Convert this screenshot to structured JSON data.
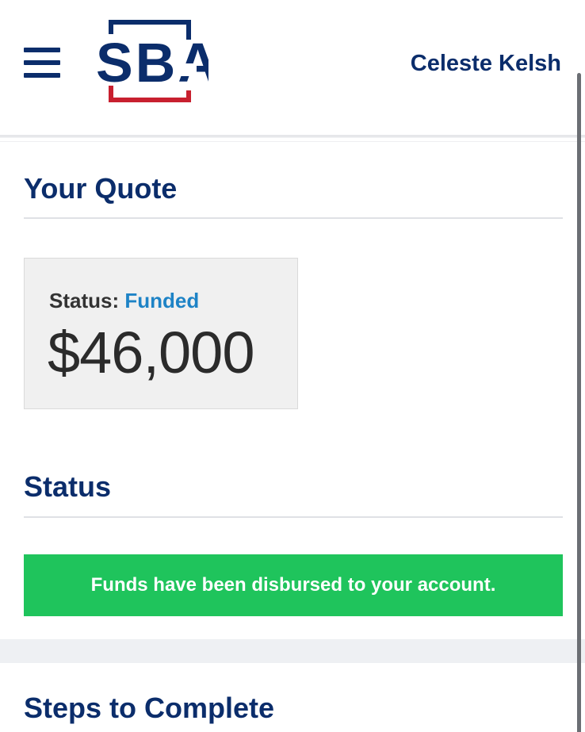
{
  "header": {
    "logo_text": "SBA",
    "user_name": "Celeste Kelsh"
  },
  "quote": {
    "title": "Your Quote",
    "status_label": "Status:",
    "status_value": "Funded",
    "amount": "$46,000"
  },
  "status": {
    "title": "Status",
    "message": "Funds have been disbursed to your account."
  },
  "steps": {
    "title": "Steps to Complete"
  },
  "colors": {
    "navy": "#0b2d6b",
    "brand_red": "#c8202f",
    "funded_blue": "#1e83c6",
    "success_green": "#1fc45c"
  },
  "icons": {
    "menu": "hamburger-menu-icon"
  }
}
